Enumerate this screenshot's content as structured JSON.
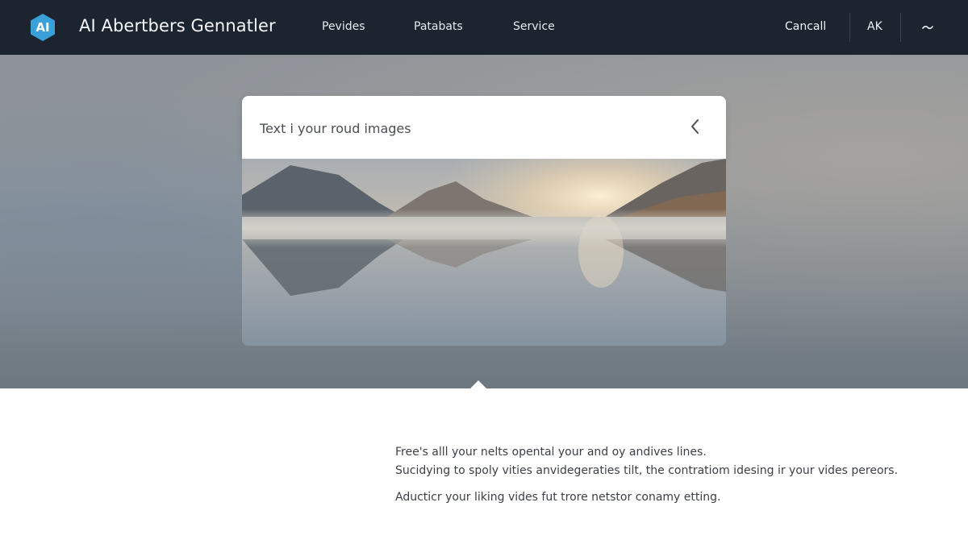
{
  "header": {
    "logo_text": "AI",
    "app_title": "AI Abertbers Gennatler",
    "nav": [
      "Pevides",
      "Patabats",
      "Service"
    ],
    "cancel_label": "Cancall",
    "user_label": "AK",
    "menu_icon": "chevron-down-icon"
  },
  "search": {
    "value": "Text i your roud images",
    "icon": "chevron-left-icon"
  },
  "preview": {
    "image": "mountain-lake-sunrise-image"
  },
  "description": {
    "line1": "Free's alll your nelts opental your and oy andives lines.",
    "line2": "Sucidying to spoly vities anvidegeraties tilt, the contratiom idesing ir your vides pereors.",
    "line3": "Aducticr your liking vides fut trore netstor conamy etting."
  },
  "colors": {
    "topbar": "#1c2430",
    "logo_accent": "#3aa0d8",
    "background": "#ffffff"
  }
}
